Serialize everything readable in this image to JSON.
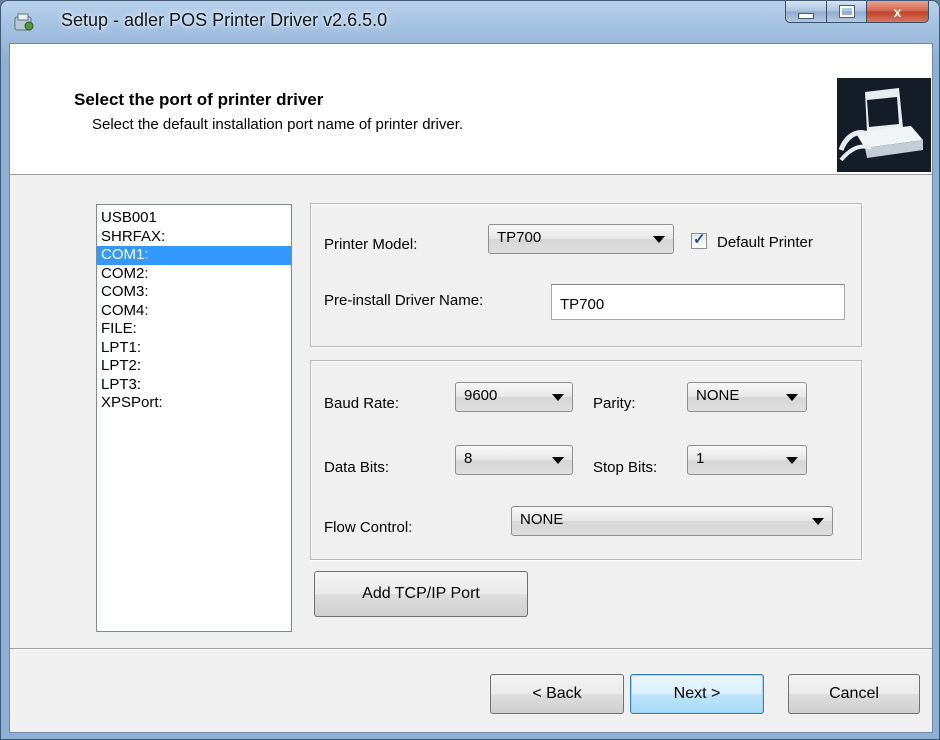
{
  "window": {
    "title": "Setup - adler POS Printer Driver v2.6.5.0",
    "close_glyph": "x"
  },
  "header": {
    "title": "Select the port of printer driver",
    "subtitle": "Select the default installation port name of printer driver."
  },
  "ports": {
    "items": [
      "USB001",
      "SHRFAX:",
      "COM1:",
      "COM2:",
      "COM3:",
      "COM4:",
      "FILE:",
      "LPT1:",
      "LPT2:",
      "LPT3:",
      "XPSPort:"
    ],
    "selected": "COM1:"
  },
  "printer": {
    "model_label": "Printer Model:",
    "model_value": "TP700",
    "default_label": "Default Printer",
    "default_checked": true,
    "driver_name_label": "Pre-install Driver Name:",
    "driver_name_value": "TP700"
  },
  "serial": {
    "baud_label": "Baud Rate:",
    "baud_value": "9600",
    "parity_label": "Parity:",
    "parity_value": "NONE",
    "databits_label": "Data Bits:",
    "databits_value": "8",
    "stopbits_label": "Stop Bits:",
    "stopbits_value": "1",
    "flow_label": "Flow Control:",
    "flow_value": "NONE"
  },
  "buttons": {
    "add_tcp": "Add TCP/IP Port",
    "back": "< Back",
    "next": "Next >",
    "cancel": "Cancel"
  },
  "colors": {
    "selection": "#3399ff",
    "titlebar": "#9ab8d9",
    "close_button": "#c2402a"
  },
  "icons": {
    "app": "setup-icon",
    "header": "printer-install-icon",
    "dropdown": "chevron-down-icon",
    "check": "checkmark-icon"
  }
}
